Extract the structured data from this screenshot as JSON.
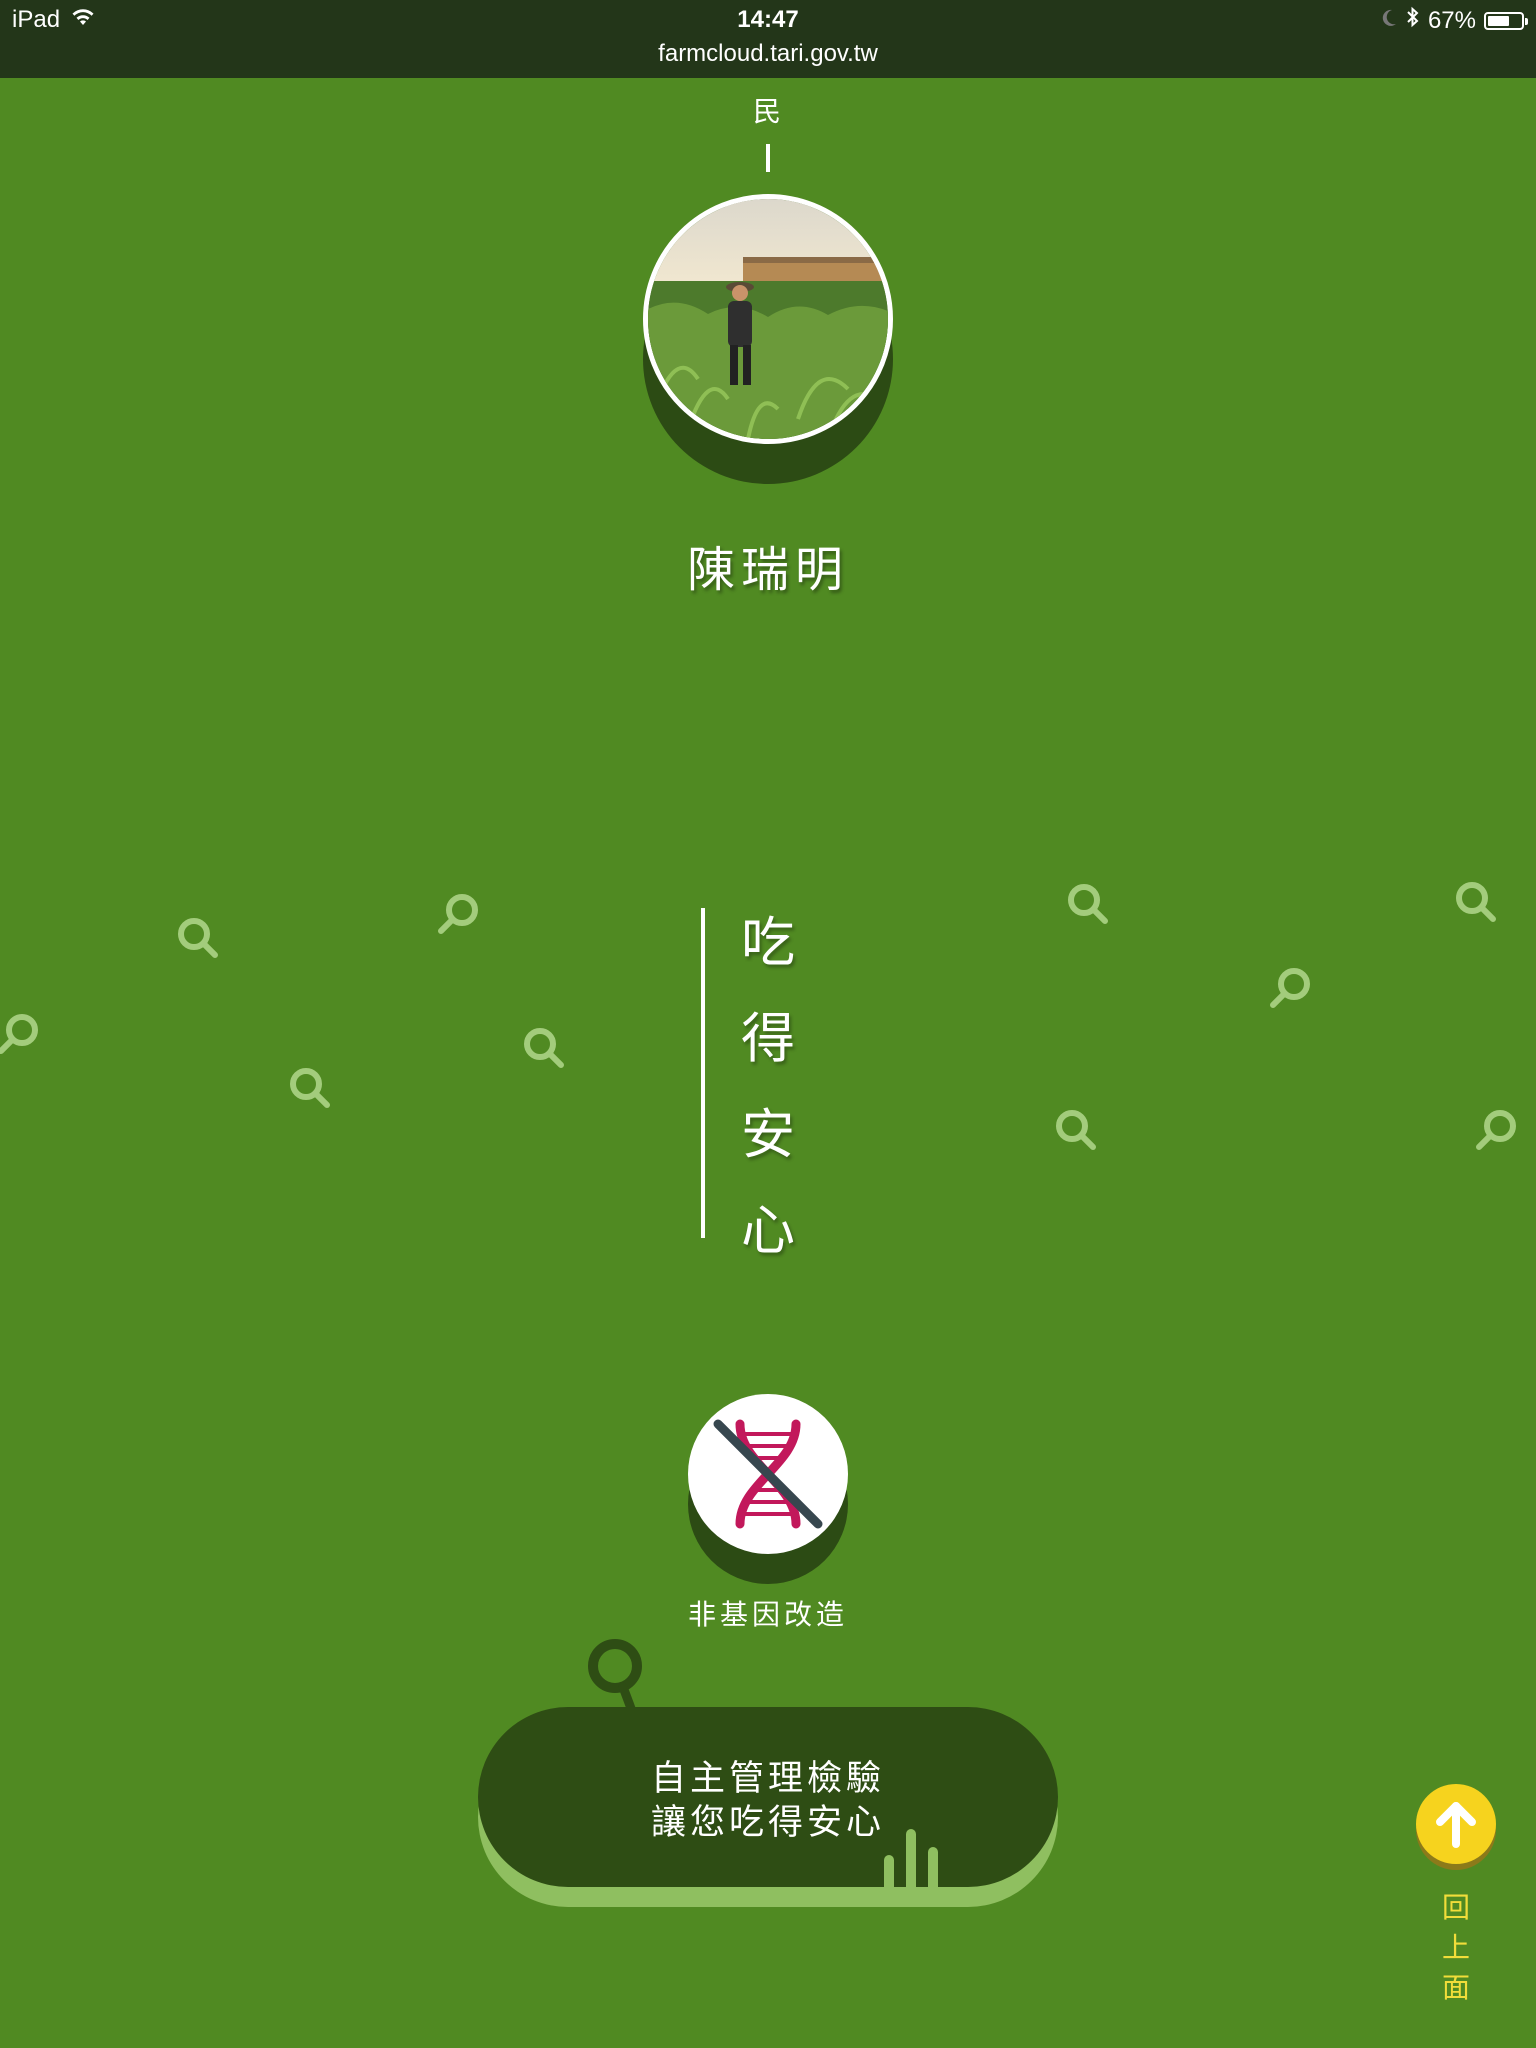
{
  "status_bar": {
    "device": "iPad",
    "time": "14:47",
    "url": "farmcloud.tari.gov.tw",
    "battery": "67%",
    "battery_level": 0.67,
    "icons": [
      "wifi-icon",
      "moon-icon",
      "bluetooth-icon",
      "battery-icon"
    ]
  },
  "farmer": {
    "section_label": "民",
    "name": "陳瑞明"
  },
  "slogan": {
    "chars": [
      "吃",
      "得",
      "安",
      "心"
    ]
  },
  "badge": {
    "label": "非基因改造",
    "icon": "non-gmo-dna-icon"
  },
  "callout": {
    "line1": "自主管理檢驗",
    "line2": "讓您吃得安心"
  },
  "back_to_top": {
    "chars": [
      "回",
      "上",
      "面"
    ],
    "icon": "arrow-up-icon"
  },
  "colors": {
    "background": "#508a22",
    "status_bar": "#233619",
    "dark_green": "#2e4d14",
    "accent_yellow": "#f6d31e",
    "dna_pink": "#d81b60"
  }
}
